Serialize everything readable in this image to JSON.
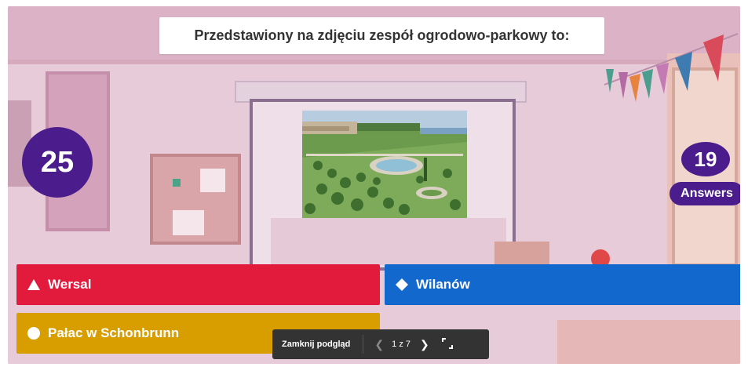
{
  "question": {
    "text": "Przedstawiony na zdjęciu zespół ogrodowo-parkowy to:"
  },
  "timer": {
    "value": "25"
  },
  "answers_counter": {
    "count": "19",
    "label": "Answers"
  },
  "image": {
    "icon": "garden-photo"
  },
  "answers": [
    {
      "label": "Wersal",
      "color": "#e21b3c",
      "icon": "triangle-icon"
    },
    {
      "label": "Wilanów",
      "color": "#1368ce",
      "icon": "diamond-icon"
    },
    {
      "label": "Pałac w Schonbrunn",
      "color": "#d89e00",
      "icon": "circle-icon"
    }
  ],
  "controls": {
    "close_label": "Zamknij podgląd",
    "page_indicator": "1 z 7"
  },
  "colors": {
    "accent_purple": "#4a1c8c",
    "control_bar": "#333333"
  }
}
